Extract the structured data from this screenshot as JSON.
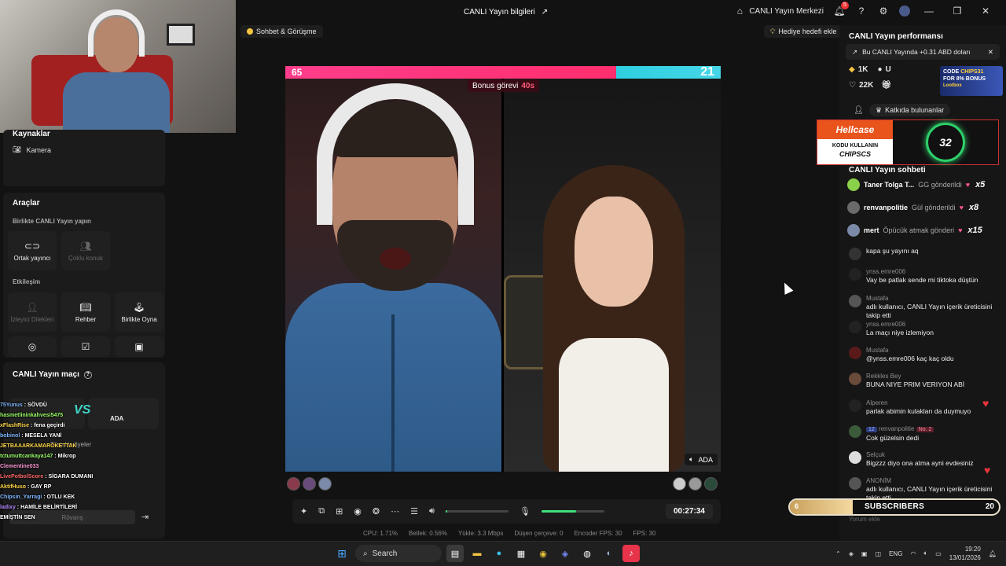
{
  "window": {
    "title": "CANLI Yayın bilgileri",
    "live_center": "CANLI Yayın Merkezi",
    "notif_count": "5"
  },
  "stage": {
    "chat_chip": "Sohbet & Görüşme",
    "gift_goal_chip": "Hediye hedefi ekle",
    "score_left": "65",
    "score_right": "21",
    "score_share_left": 0.76,
    "bonus_label": "Bonus görevi",
    "bonus_time": "40s",
    "opponent_name": "ADA",
    "timer": "00:27:34",
    "mic_level": 0.55,
    "speaker_level": 0.02
  },
  "stats": [
    "CPU: 1.71%",
    "Bellek: 0.56%",
    "Yükle: 3.3 Mbps",
    "Düşen çerçeve: 0",
    "Encoder FPS: 30",
    "FPS: 30"
  ],
  "left": {
    "sources_title": "Kaynaklar",
    "camera": "Kamera",
    "tools_title": "Araçlar",
    "together_sub": "Birlikte CANLI Yayın yapın",
    "cohost": "Ortak yayıncı",
    "multi_guest": "Çoklu konuk",
    "interaction_sub": "Etkileşim",
    "viewer_requests": "İzleyici Dilekleri",
    "guide": "Rehber",
    "play_together": "Birlikte Oyna",
    "match_title": "CANLI Yayın maçı",
    "all_gifts": "Tüm Hediyeler",
    "rematch": "Rövanş"
  },
  "overlay_chat": [
    {
      "user": "75Yunus",
      "text": "SÖVDÜ",
      "color": "#7fb8ff"
    },
    {
      "user": "hasmetlininkahvesi5475",
      "text": "",
      "color": "#9cff6a"
    },
    {
      "user": "xFlashRise",
      "text": "fena geçirdi",
      "color": "#ffd84a"
    },
    {
      "user": "bobinol",
      "text": "MESELA YANİ",
      "color": "#7fb8ff"
    },
    {
      "user": "JETBAAARKAMAROKETTAK",
      "text": "",
      "color": "#ffd84a"
    },
    {
      "user": "tctumuttcankaya147",
      "text": "Mikrop",
      "color": "#9cff6a"
    },
    {
      "user": "Clementine033",
      "text": "",
      "color": "#ff9ad8"
    },
    {
      "user": "LivePotbolScore",
      "text": "SİGARA DUMANI",
      "color": "#ff6a6a"
    },
    {
      "user": "AktifHuso",
      "text": "GAY RP",
      "color": "#ffd84a"
    },
    {
      "user": "Chipsin_Yarragi",
      "text": "OTLU KEK",
      "color": "#7fb8ff"
    },
    {
      "user": "ladixy",
      "text": "HAMİLE BELİRTİLERİ",
      "color": "#b58aff"
    },
    {
      "user": "",
      "text": "EMİŞTİN SEN",
      "color": "#ffffff"
    }
  ],
  "right": {
    "perf_title": "CANLI Yayın performansı",
    "earnings": "Bu CANLI Yayında +0.31 ABD doları",
    "coins": "1K",
    "likes": "22K",
    "coin_suffix": "U",
    "promo_code": "CODE",
    "promo_value": "CHIPS31",
    "promo_bonus": "FOR 8% BONUS",
    "promo_brand": "Lootbox",
    "contributors": "Katkıda bulunanlar",
    "hellcase": "Hellcase",
    "hellcase_sub": "KODU KULLANIN",
    "hellcase_code": "CHIPSCS",
    "ring_value": "32",
    "chat_title": "CANLI Yayın sohbeti",
    "gifts": [
      {
        "user": "Taner Tolga T...",
        "text": "GG gönderildi",
        "mult": "x5",
        "color": "#8ad04a"
      },
      {
        "user": "renvanpolitie",
        "text": "Gül gönderildi",
        "mult": "x8",
        "color": "#6a6a6a"
      },
      {
        "user": "mert",
        "text": "Öpücük atmak gönderi",
        "mult": "x15",
        "color": "#7a8aa8"
      }
    ],
    "messages": [
      {
        "name": "",
        "text": "kapa şu yayını aq",
        "color": "#333"
      },
      {
        "name": "ynss.emre006",
        "text": "Vay be patlak sende mi tiktoka düştün",
        "color": "#222"
      },
      {
        "name": "Mustafa",
        "text": "adlı kullanıcı, CANLI Yayın içerik üreticisini takip etti",
        "color": "#555"
      },
      {
        "name": "ynss.emre006",
        "text": "La maçı niye izlemiyon",
        "color": "#222"
      },
      {
        "name": "Mustafa",
        "text": "@ynss.emre006 kaç kaç oldu",
        "color": "#5a1a1a"
      },
      {
        "name": "Rekkles Bey",
        "text": "BUNA NIYE PRIM VERIYON ABİ",
        "color": "#6a4a3a"
      },
      {
        "name": "Alperen",
        "text": "parlak abimin kulakları da duymuyo",
        "color": "#222"
      },
      {
        "name": "renvanpolitie",
        "text": "Cok güzelsin dedi",
        "color": "#3a5a3a"
      },
      {
        "name": "Selçuk",
        "text": "Bigzzz diyo ona atma ayni evdesiniz",
        "color": "#ddd"
      },
      {
        "name": "ANONİM",
        "text": "adlı kullanıcı, CANLI Yayın içerik üreticisini takip etti",
        "color": "#555"
      }
    ],
    "level_badge": "12",
    "rank_badge": "No. 2",
    "sub_left": "6",
    "sub_title": "SUBSCRIBERS",
    "sub_right": "20",
    "sub_progress": 0.3,
    "comment_placeholder": "Yorum ekle"
  },
  "taskbar": {
    "search": "Search",
    "lang": "ENG",
    "time": "19:20",
    "date": "13/01/2026"
  }
}
